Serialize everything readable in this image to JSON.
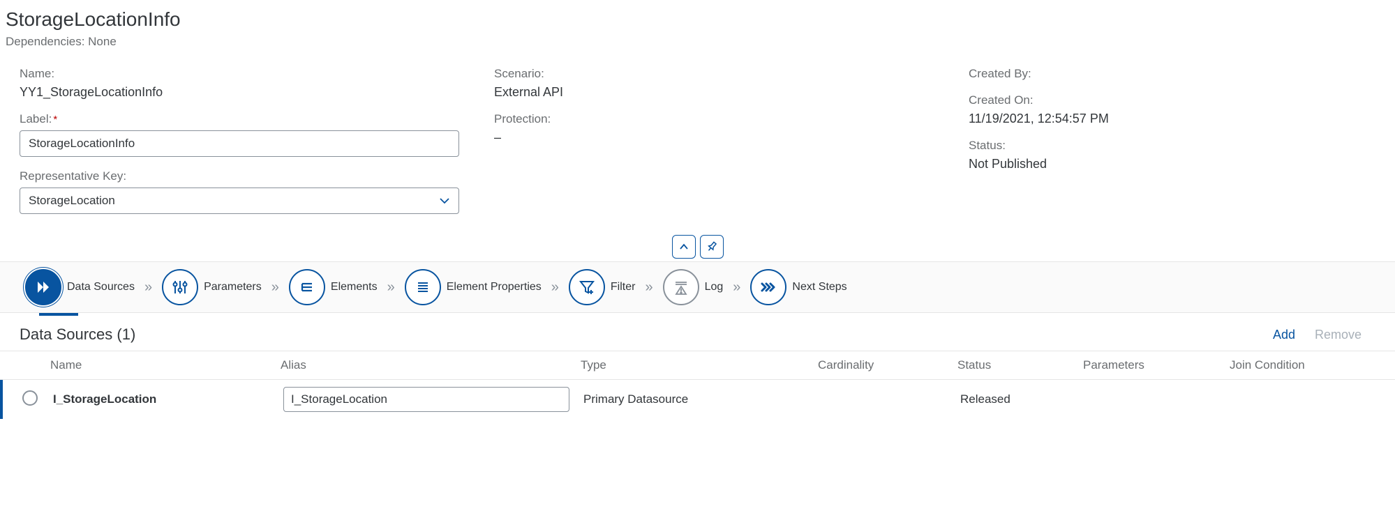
{
  "header": {
    "title": "StorageLocationInfo",
    "dependencies_label": "Dependencies:",
    "dependencies_value": "None"
  },
  "form": {
    "name_label": "Name:",
    "name_value": "YY1_StorageLocationInfo",
    "label_label": "Label:",
    "label_value": "StorageLocationInfo",
    "repkey_label": "Representative Key:",
    "repkey_value": "StorageLocation",
    "scenario_label": "Scenario:",
    "scenario_value": "External API",
    "protection_label": "Protection:",
    "protection_value": "–",
    "createdby_label": "Created By:",
    "createdby_value": "",
    "createdon_label": "Created On:",
    "createdon_value": "11/19/2021, 12:54:57 PM",
    "status_label": "Status:",
    "status_value": "Not Published"
  },
  "wizard": {
    "steps": [
      {
        "label": "Data Sources",
        "icon": "play-double"
      },
      {
        "label": "Parameters",
        "icon": "sliders"
      },
      {
        "label": "Elements",
        "icon": "list-stack"
      },
      {
        "label": "Element Properties",
        "icon": "list-lines"
      },
      {
        "label": "Filter",
        "icon": "funnel-plus"
      },
      {
        "label": "Log",
        "icon": "warning-lines"
      },
      {
        "label": "Next Steps",
        "icon": "fast-forward"
      }
    ]
  },
  "section": {
    "title": "Data Sources (1)",
    "add_label": "Add",
    "remove_label": "Remove"
  },
  "table": {
    "headers": {
      "name": "Name",
      "alias": "Alias",
      "type": "Type",
      "cardinality": "Cardinality",
      "status": "Status",
      "parameters": "Parameters",
      "join": "Join Condition"
    },
    "rows": [
      {
        "name": "I_StorageLocation",
        "alias": "I_StorageLocation",
        "type": "Primary Datasource",
        "cardinality": "",
        "status": "Released",
        "parameters": "",
        "join": ""
      }
    ]
  }
}
